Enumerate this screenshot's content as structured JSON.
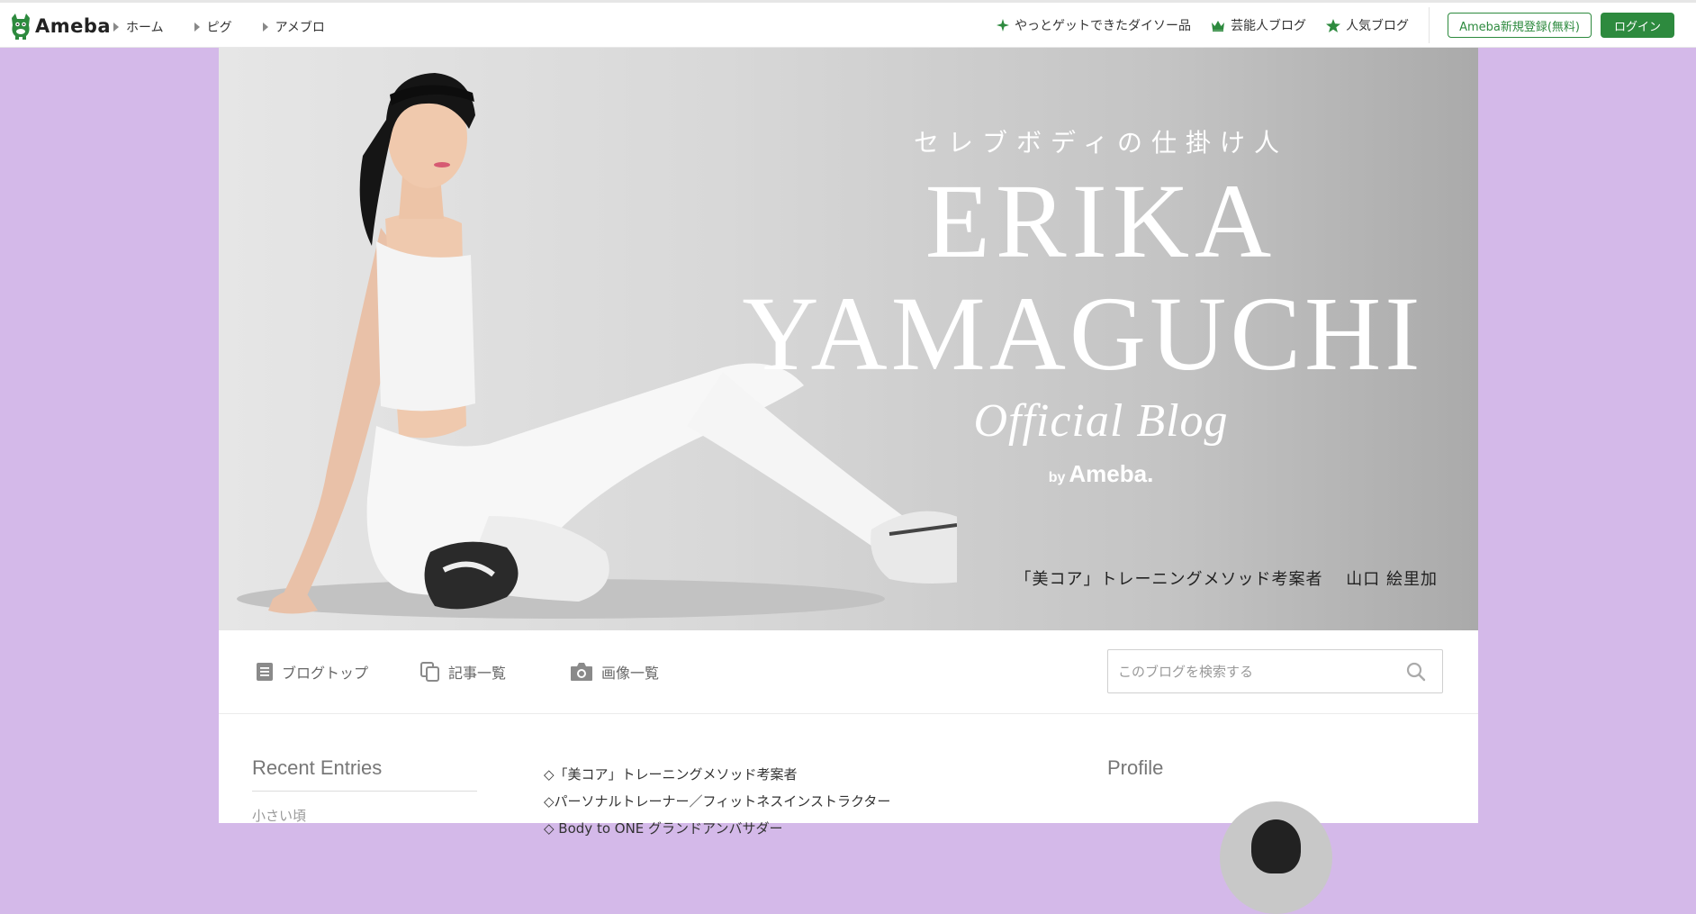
{
  "topbar": {
    "logo_text": "Ameba",
    "nav": [
      "ホーム",
      "ピグ",
      "アメブロ"
    ],
    "promos": [
      {
        "label": "やっとゲットできたダイソー品",
        "icon": "sparkle-icon"
      },
      {
        "label": "芸能人ブログ",
        "icon": "crown-icon"
      },
      {
        "label": "人気ブログ",
        "icon": "star-icon"
      }
    ],
    "signup_label": "Ameba新規登録(無料)",
    "login_label": "ログイン",
    "accent": "#2d8a3e"
  },
  "hero": {
    "kicker": "セレブボディの仕掛け人",
    "name_line1": "ERIKA",
    "name_line2": "YAMAGUCHI",
    "official": "Official Blog",
    "by": "by",
    "brand": "Ameba.",
    "caption": "「美コア」トレーニングメソッド考案者　 山口 絵里加"
  },
  "subnav": {
    "items": [
      {
        "label": "ブログトップ",
        "icon": "document-icon"
      },
      {
        "label": "記事一覧",
        "icon": "copy-icon"
      },
      {
        "label": "画像一覧",
        "icon": "camera-icon"
      }
    ],
    "search_placeholder": "このブログを検索する"
  },
  "sidebar": {
    "recent_title": "Recent Entries",
    "entries": [
      "小さい頃"
    ]
  },
  "main": {
    "lines": [
      "◇「美コア」トレーニングメソッド考案者",
      "◇パーソナルトレーナー／フィットネスインストラクター",
      "◇ Body to ONE グランドアンバサダー"
    ]
  },
  "profile": {
    "title": "Profile"
  },
  "colors": {
    "page_bg": "#d4b9e9",
    "hero_bg": "#d0d0d0"
  }
}
